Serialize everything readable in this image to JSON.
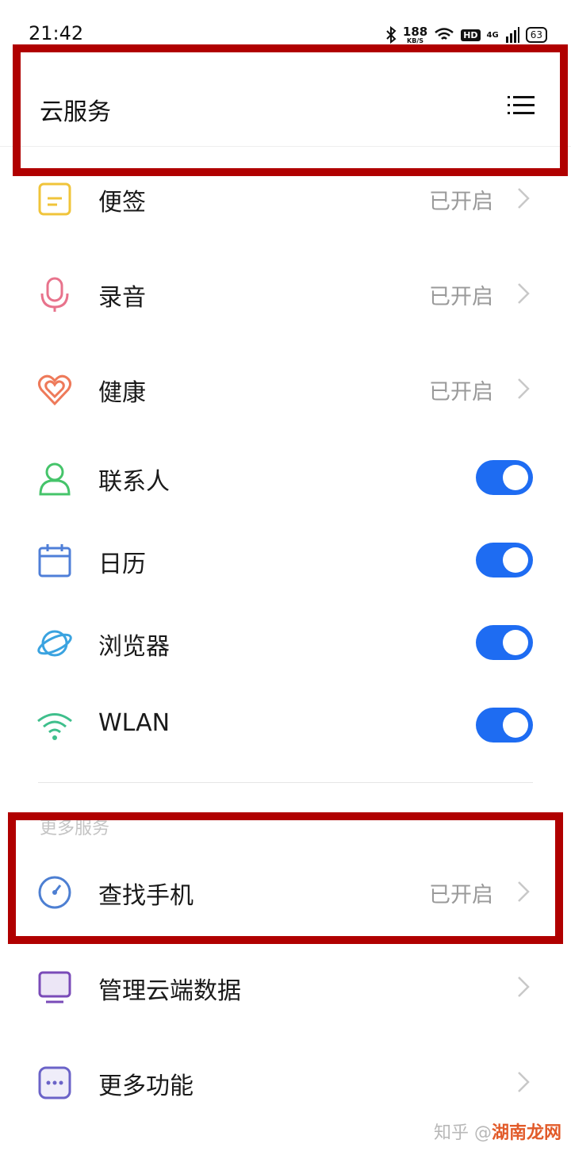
{
  "status_bar": {
    "time": "21:42",
    "net_speed_value": "188",
    "net_speed_unit": "KB/S",
    "hd": "HD",
    "signal_label": "4G",
    "battery": "63"
  },
  "header": {
    "title": "云服务",
    "menu_icon": "list-menu-icon"
  },
  "sync_items": [
    {
      "label": "便签",
      "status": "已开启",
      "icon": "notes-icon",
      "color": "#f0c43a"
    },
    {
      "label": "录音",
      "status": "已开启",
      "icon": "microphone-icon",
      "color": "#e8738c"
    },
    {
      "label": "健康",
      "status": "已开启",
      "icon": "heart-icon",
      "color": "#ee7a5a"
    },
    {
      "label": "联系人",
      "toggle": true,
      "icon": "contact-icon",
      "color": "#45c46a"
    },
    {
      "label": "日历",
      "toggle": true,
      "icon": "calendar-icon",
      "color": "#4f7fd8"
    },
    {
      "label": "浏览器",
      "toggle": true,
      "icon": "browser-planet-icon",
      "color": "#3aa3e0"
    },
    {
      "label": "WLAN",
      "toggle": true,
      "icon": "wifi-icon",
      "color": "#3fbf8c"
    }
  ],
  "more_section": {
    "title": "更多服务",
    "items": [
      {
        "label": "查找手机",
        "status": "已开启",
        "icon": "find-phone-icon",
        "color": "#4d7fd2"
      },
      {
        "label": "管理云端数据",
        "icon": "monitor-icon",
        "color": "#7a4bb8"
      },
      {
        "label": "更多功能",
        "icon": "more-dots-icon",
        "color": "#6b63c8"
      }
    ]
  },
  "watermark": {
    "prefix": "知乎 @",
    "brand": "湖南龙网"
  },
  "colors": {
    "toggle_on": "#1e6cf2",
    "highlight_frame": "#b00000"
  }
}
